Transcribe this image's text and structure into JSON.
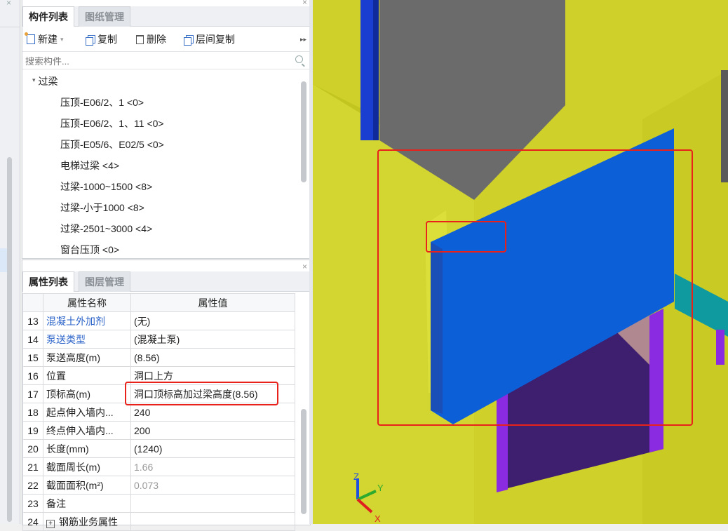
{
  "component_panel": {
    "tabs": [
      "构件列表",
      "图纸管理"
    ],
    "toolbar": {
      "new": "新建",
      "copy": "复制",
      "delete": "删除",
      "floor_copy": "层间复制",
      "more": "▸▸"
    },
    "search_placeholder": "搜索构件...",
    "tree_root": "过梁",
    "items": [
      "压顶-E06/2、1 <0>",
      "压顶-E06/2、1、11 <0>",
      "压顶-E05/6、E02/5 <0>",
      "电梯过梁 <4>",
      "过梁-1000~1500 <8>",
      "过梁-小于1000 <8>",
      "过梁-2501~3000 <4>",
      "窗台压顶 <0>"
    ]
  },
  "property_panel": {
    "tabs": [
      "属性列表",
      "图层管理"
    ],
    "headers": [
      "属性名称",
      "属性值"
    ],
    "rows": [
      {
        "num": "13",
        "name": "混凝土外加剂",
        "value": "(无)"
      },
      {
        "num": "14",
        "name": "泵送类型",
        "value": "(混凝土泵)"
      },
      {
        "num": "15",
        "name": "泵送高度(m)",
        "value": "(8.56)"
      },
      {
        "num": "16",
        "name": "位置",
        "value": "洞口上方"
      },
      {
        "num": "17",
        "name": "顶标高(m)",
        "value": "洞口顶标高加过梁高度(8.56)"
      },
      {
        "num": "18",
        "name": "起点伸入墙内...",
        "value": "240"
      },
      {
        "num": "19",
        "name": "终点伸入墙内...",
        "value": "200"
      },
      {
        "num": "20",
        "name": "长度(mm)",
        "value": "(1240)"
      },
      {
        "num": "21",
        "name": "截面周长(m)",
        "value": "1.66"
      },
      {
        "num": "22",
        "name": "截面面积(m²)",
        "value": "0.073"
      },
      {
        "num": "23",
        "name": "备注",
        "value": ""
      },
      {
        "num": "24",
        "name": "钢筋业务属性",
        "value": ""
      }
    ],
    "expand_glyph": "+"
  },
  "view3d": {
    "axis_labels": {
      "z": "Z",
      "y": "Y",
      "x": "X"
    },
    "colors": {
      "background": "#cfd02a",
      "wall_light": "#d6d82f",
      "wall_dark": "#bdbf20",
      "beam": "#0d5fd8",
      "column_grey": "#6b6b6b",
      "purple": "#8a2be2",
      "teal": "#0f9aa0",
      "highlight": "#e8211b"
    }
  }
}
